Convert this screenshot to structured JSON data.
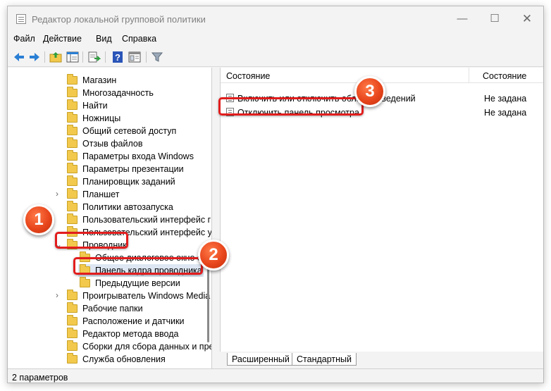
{
  "window": {
    "title": "Редактор локальной групповой политики"
  },
  "menu": [
    "Файл",
    "Действие",
    "Вид",
    "Справка"
  ],
  "toolbar": {
    "icons": [
      "back-arrow-icon",
      "forward-arrow-icon",
      "up-folder-icon",
      "show-hide-tree-icon",
      "export-list-icon",
      "help-icon",
      "properties-icon",
      "filter-icon"
    ]
  },
  "tree": {
    "items": [
      {
        "label": "Магазин"
      },
      {
        "label": "Многозадачность"
      },
      {
        "label": "Найти"
      },
      {
        "label": "Ножницы"
      },
      {
        "label": "Общий сетевой доступ"
      },
      {
        "label": "Отзыв файлов"
      },
      {
        "label": "Параметры входа Windows"
      },
      {
        "label": "Параметры презентации"
      },
      {
        "label": "Планировщик заданий"
      },
      {
        "label": "Планшет",
        "expander": "›"
      },
      {
        "label": "Политики автозапуска"
      },
      {
        "label": "Пользовательский интерфейс г"
      },
      {
        "label": "Пользовательский интерфейс у"
      },
      {
        "label": "Проводник",
        "expander": "⌄"
      },
      {
        "label": "Общее диалоговое окно о"
      },
      {
        "label": "Панель кадра проводника"
      },
      {
        "label": "Предыдущие версии"
      },
      {
        "label": "Проигрыватель Windows Media",
        "expander": "›"
      },
      {
        "label": "Рабочие папки"
      },
      {
        "label": "Расположение и датчики"
      },
      {
        "label": "Редактор метода ввода"
      },
      {
        "label": "Сборки для сбора данных и пре"
      },
      {
        "label": "Служба обновления"
      }
    ]
  },
  "list": {
    "columns": [
      "Состояние",
      "Состояние"
    ],
    "rows": [
      {
        "name": "Включить или отключить области сведений",
        "state": "Не задана"
      },
      {
        "name": "Отключить панель просмотра",
        "state": "Не задана"
      }
    ]
  },
  "tabs": [
    "Расширенный",
    "Стандартный"
  ],
  "status": "2 параметров",
  "annotations": {
    "badges": [
      "1",
      "2",
      "3"
    ],
    "color": "#e21d1d"
  }
}
